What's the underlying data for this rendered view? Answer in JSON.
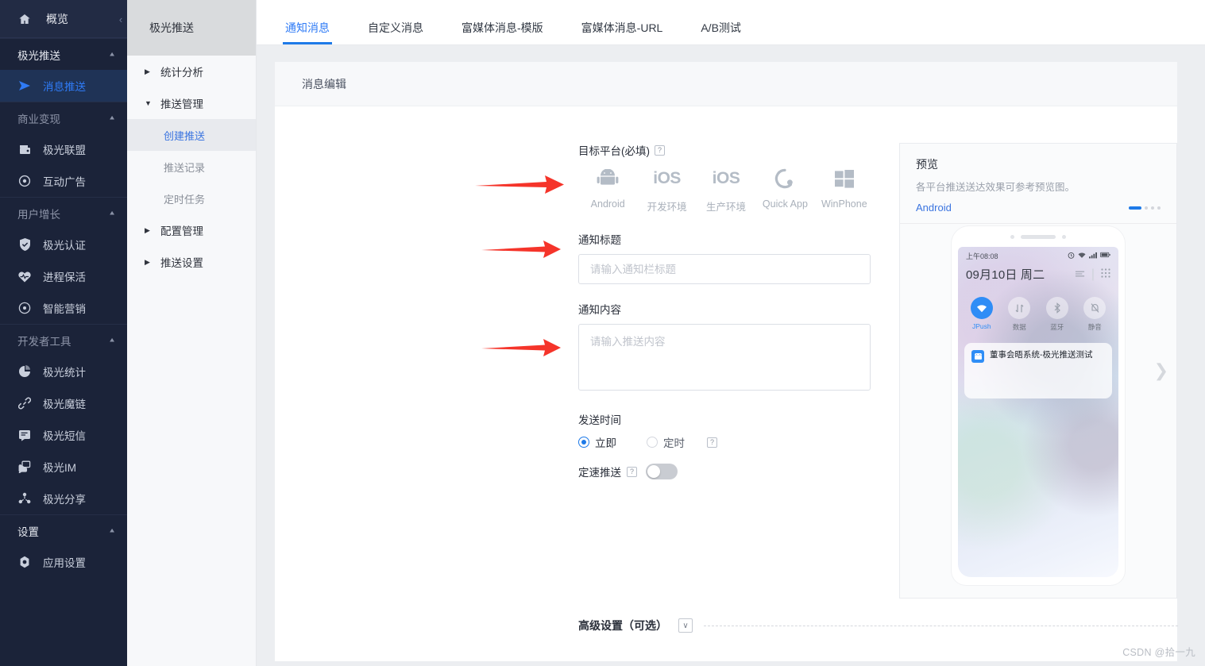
{
  "sidebar": {
    "overview": {
      "label": "概览",
      "icon": "home-icon"
    },
    "collapse_icon": "chevron-left-icon",
    "groups": [
      {
        "label": "极光推送",
        "caret": "chevron-up-icon",
        "items": [
          {
            "label": "消息推送",
            "icon": "send-icon",
            "active": true
          }
        ]
      },
      {
        "label": "商业变现",
        "caret": "chevron-up-icon",
        "items": [
          {
            "label": "极光联盟",
            "icon": "wallet-icon",
            "active": false
          },
          {
            "label": "互动广告",
            "icon": "target-icon",
            "active": false
          }
        ]
      },
      {
        "label": "用户增长",
        "caret": "chevron-up-icon",
        "items": [
          {
            "label": "极光认证",
            "icon": "shield-check-icon",
            "active": false
          },
          {
            "label": "进程保活",
            "icon": "heartbeat-icon",
            "active": false
          },
          {
            "label": "智能营销",
            "icon": "circle-dot-icon",
            "active": false
          }
        ]
      },
      {
        "label": "开发者工具",
        "caret": "chevron-up-icon",
        "items": [
          {
            "label": "极光统计",
            "icon": "pie-chart-icon",
            "active": false
          },
          {
            "label": "极光魔链",
            "icon": "link-icon",
            "active": false
          },
          {
            "label": "极光短信",
            "icon": "message-icon",
            "active": false
          },
          {
            "label": "极光IM",
            "icon": "chat-icon",
            "active": false
          },
          {
            "label": "极光分享",
            "icon": "share-icon",
            "active": false
          }
        ]
      },
      {
        "label": "设置",
        "caret": "chevron-up-icon",
        "items": [
          {
            "label": "应用设置",
            "icon": "gear-icon",
            "active": false
          }
        ]
      }
    ]
  },
  "subnav": {
    "title": "极光推送",
    "rows": [
      {
        "label": "统计分析",
        "caret": "chevron-right-icon",
        "expanded": false
      },
      {
        "label": "推送管理",
        "caret": "chevron-down-icon",
        "expanded": true
      }
    ],
    "children": [
      {
        "label": "创建推送",
        "active": true
      },
      {
        "label": "推送记录",
        "active": false
      },
      {
        "label": "定时任务",
        "active": false
      }
    ],
    "rows2": [
      {
        "label": "配置管理",
        "caret": "chevron-right-icon"
      },
      {
        "label": "推送设置",
        "caret": "chevron-right-icon"
      }
    ]
  },
  "tabs": [
    {
      "label": "通知消息",
      "active": true
    },
    {
      "label": "自定义消息",
      "active": false
    },
    {
      "label": "富媒体消息-模版",
      "active": false
    },
    {
      "label": "富媒体消息-URL",
      "active": false
    },
    {
      "label": "A/B测试",
      "active": false
    }
  ],
  "panel": {
    "head_title": "消息编辑"
  },
  "form": {
    "platform_label": "目标平台(必填)",
    "platform_help": "?",
    "platforms": [
      {
        "name": "Android",
        "icon": "android-icon"
      },
      {
        "name": "开发环境",
        "icon": "ios-icon"
      },
      {
        "name": "生产环境",
        "icon": "ios-icon"
      },
      {
        "name": "Quick App",
        "icon": "quickapp-icon"
      },
      {
        "name": "WinPhone",
        "icon": "windows-icon"
      }
    ],
    "title_label": "通知标题",
    "title_value": "",
    "title_placeholder": "请输入通知栏标题",
    "content_label": "通知内容",
    "content_value": "",
    "content_placeholder": "请输入推送内容",
    "sendtime_label": "发送时间",
    "radio_now": "立即",
    "radio_schedule": "定时",
    "schedule_help": "?",
    "rate_label": "定速推送",
    "rate_help": "?",
    "rate_on": false,
    "advanced_label": "高级设置（可选）",
    "advanced_caret": "chevron-down-icon"
  },
  "preview": {
    "title": "预览",
    "subtitle": "各平台推送送达效果可参考预览图。",
    "os": "Android",
    "next_icon": "chevron-right-icon",
    "phone": {
      "time": "上午08:08",
      "status_icons": [
        "alarm-icon",
        "wifi-icon",
        "signal-icon",
        "battery-icon"
      ],
      "date": "09月10日  周二",
      "menu_icon": "list-icon",
      "grid_icon": "grid-icon",
      "quick_settings": [
        {
          "label": "JPush",
          "icon": "wifi-icon",
          "on": true
        },
        {
          "label": "数据",
          "icon": "data-icon",
          "on": false
        },
        {
          "label": "蓝牙",
          "icon": "bluetooth-icon",
          "on": false
        },
        {
          "label": "静音",
          "icon": "bell-off-icon",
          "on": false
        }
      ],
      "notification": {
        "app_icon": "jpush-app-icon",
        "text": "董事会晤系统-极光推送测试"
      }
    }
  },
  "annotations": {
    "arrows": [
      {
        "name": "arrow-to-platform"
      },
      {
        "name": "arrow-to-title"
      },
      {
        "name": "arrow-to-content"
      }
    ]
  },
  "watermark": "CSDN @拾一九",
  "colors": {
    "accent": "#1e7ae8",
    "sidebar_bg": "#1b2339",
    "active_nav": "#2f7bf6",
    "arrow_red": "#f5342a"
  }
}
